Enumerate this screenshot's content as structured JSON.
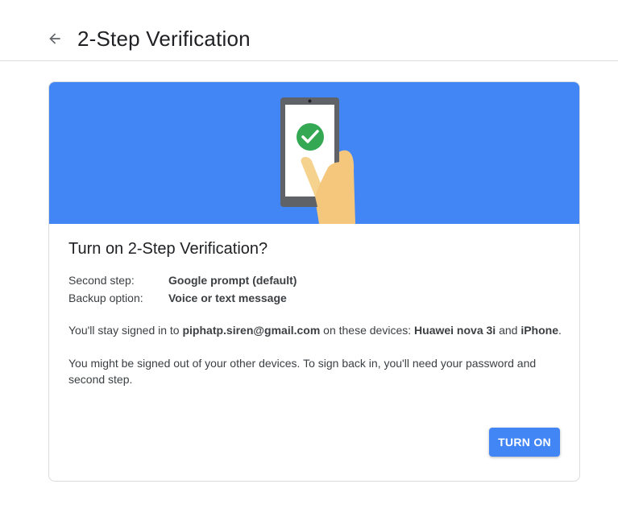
{
  "header": {
    "title": "2-Step Verification"
  },
  "card": {
    "title": "Turn on 2-Step Verification?",
    "info": [
      {
        "label": "Second step:",
        "value": "Google prompt (default)"
      },
      {
        "label": "Backup option:",
        "value": "Voice or text message"
      }
    ],
    "signed_in": {
      "pre": "You'll stay signed in to ",
      "email": "piphatp.siren@gmail.com",
      "mid": " on these devices: ",
      "device1": "Huawei nova 3i",
      "and": " and ",
      "device2": "iPhone",
      "end": "."
    },
    "warning": "You might be signed out of your other devices. To sign back in, you'll need your password and second step.",
    "button_label": "TURN ON"
  },
  "colors": {
    "accent": "#4285f4",
    "success": "#34a853"
  },
  "icons": [
    "back-arrow-icon",
    "check-circle-icon"
  ]
}
